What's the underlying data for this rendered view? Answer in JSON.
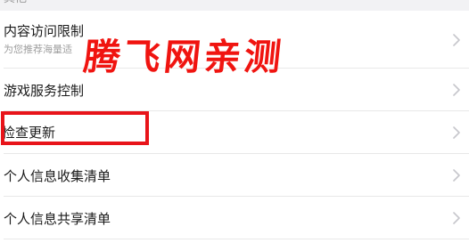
{
  "section": {
    "label": "其他"
  },
  "settings": {
    "items": [
      {
        "title": "内容访问限制",
        "subtitle": "为您推荐海量适"
      },
      {
        "title": "游戏服务控制"
      },
      {
        "title": "检查更新"
      },
      {
        "title": "个人信息收集清单"
      },
      {
        "title": "个人信息共享清单"
      }
    ]
  },
  "overlay": {
    "watermark_text": "腾飞网亲测",
    "watermark_color": "#f01410",
    "highlight_color": "#e8141a"
  },
  "icons": {
    "row_trailing": "chevron-right-icon"
  },
  "colors": {
    "section_background": "#f2f2f4",
    "divider": "#e8e8e8",
    "title_text": "#1a1a1a",
    "subtitle_text": "#9e9e9e",
    "chevron": "#c7c7cc"
  }
}
